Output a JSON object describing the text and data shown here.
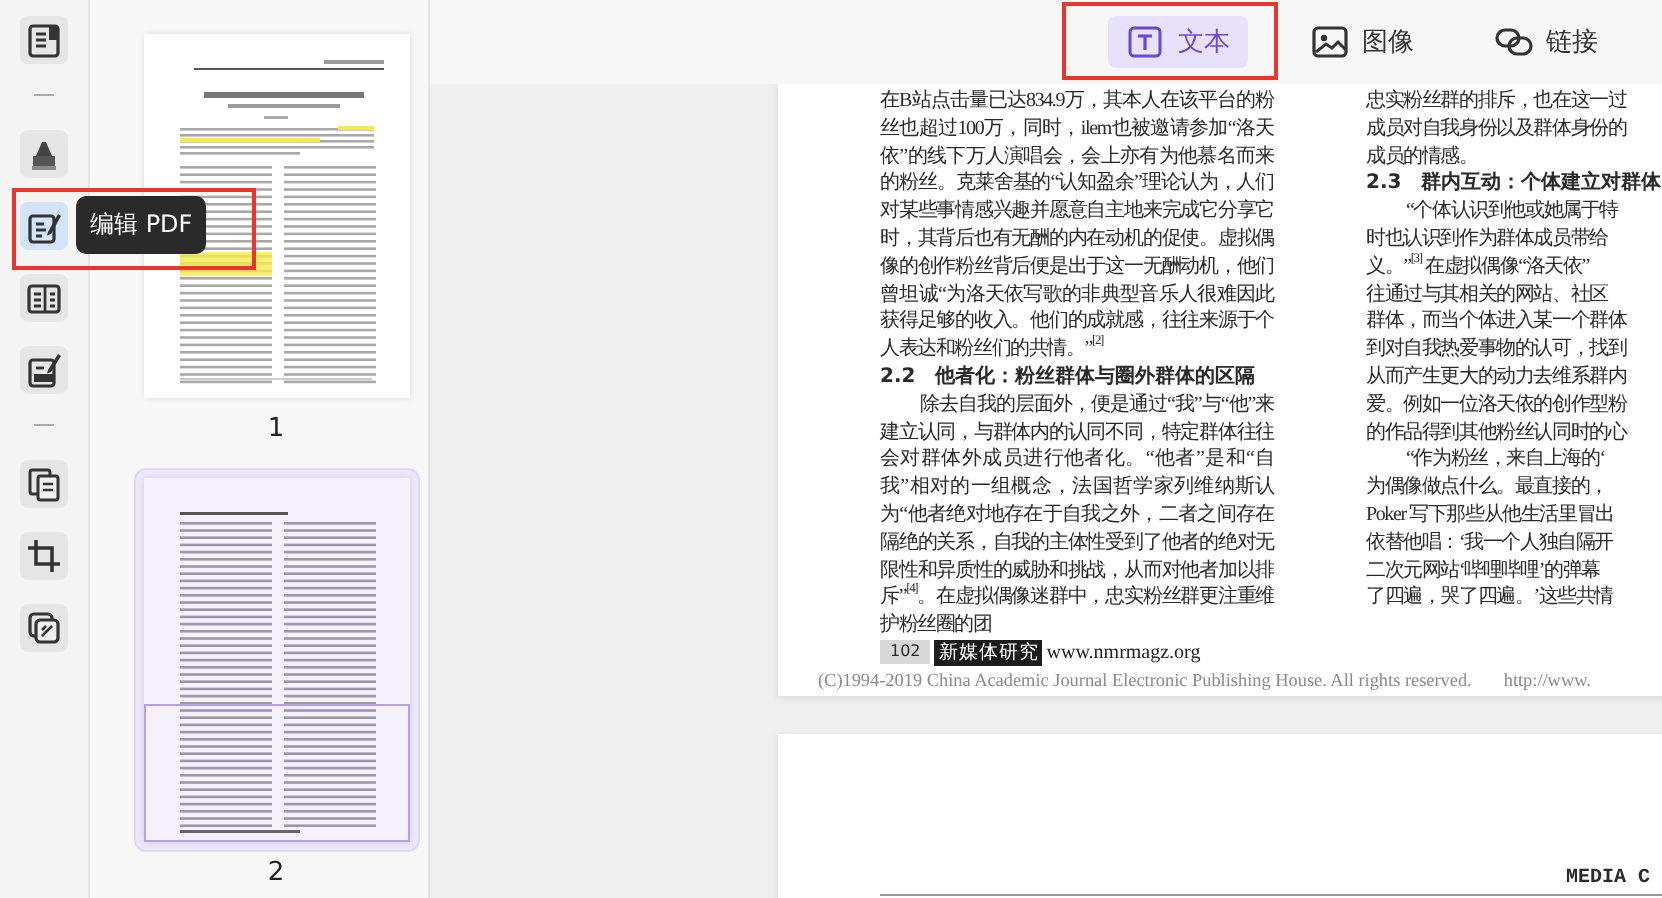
{
  "toolbar": {
    "tooltip": "编辑 PDF",
    "tool_groups": [
      {
        "tools": [
          {
            "kind": "reader",
            "selected": false,
            "annotated": false
          }
        ]
      },
      {
        "tools": [
          {
            "kind": "highlighter",
            "selected": false,
            "annotated": false
          },
          {
            "kind": "edit",
            "selected": true,
            "annotated": true
          },
          {
            "kind": "columns",
            "selected": false,
            "annotated": false
          },
          {
            "kind": "form",
            "selected": false,
            "annotated": false
          }
        ]
      },
      {
        "tools": [
          {
            "kind": "pages",
            "selected": false,
            "annotated": false
          },
          {
            "kind": "crop",
            "selected": false,
            "annotated": false
          },
          {
            "kind": "layers",
            "selected": false,
            "annotated": false
          }
        ]
      }
    ]
  },
  "thumbnails": [
    {
      "label": "1",
      "kind": "title_page",
      "selected": false
    },
    {
      "label": "2",
      "kind": "body_page",
      "selected": true
    }
  ],
  "edit_tabs": [
    {
      "kind": "text",
      "label": "文本",
      "selected": true,
      "annotated": true
    },
    {
      "kind": "image",
      "label": "图像",
      "selected": false,
      "annotated": false
    },
    {
      "kind": "link",
      "label": "链接",
      "selected": false,
      "annotated": false
    }
  ],
  "document": {
    "page_1": {
      "left_column": [
        {
          "kind": "paragraph",
          "indent": false,
          "text": "在B站点击量已达834.9万，其本人在该平台的粉丝也超过100万，同时，ilem也被邀请参加“洛天依”的线下万人演唱会，会上亦有为他慕名而来的粉丝。克莱舍基的“认知盈余”理论认为，人们对某些事情感兴趣并愿意自主地来完成它分享它时，其背后也有无酬的内在动机的促使。虚拟偶像的创作粉丝背后便是出于这一无酬动机，他们曾坦诚“为洛天依写歌的非典型音乐人很难因此获得足够的收入。他们的成就感，往往来源于个人表达和粉丝们的共情。”$^{[2]}$"
        },
        {
          "kind": "heading",
          "indent": false,
          "text": "2.2　他者化：粉丝群体与圈外群体的区隔"
        },
        {
          "kind": "paragraph",
          "indent": true,
          "text": "除去自我的层面外，便是通过“我”与“他”来建立认同，与群体内的认同不同，特定群体往往会对群体外成员进行他者化。“他者”是和“自我”相对的一组概念，法国哲学家列维纳斯认为“他者绝对地存在于自我之外，二者之间存在隔绝的关系，自我的主体性受到了他者的绝对无限性和异质性的威胁和挑战，从而对他者加以排斥”$^{[4]}$。在虚拟偶像迷群中，忠实粉丝群更注重维护粉丝圈的团"
        }
      ],
      "right_column": [
        {
          "kind": "line",
          "indent": false,
          "text": "忠实粉丝群的排斥，也在这一过"
        },
        {
          "kind": "line",
          "indent": false,
          "text": "成员对自我身份以及群体身份的"
        },
        {
          "kind": "line",
          "indent": false,
          "text": "成员的情感。"
        },
        {
          "kind": "heading",
          "indent": false,
          "text": "2.3　群内互动：个体建立对群体"
        },
        {
          "kind": "line",
          "indent": true,
          "text": "“个体认识到他或她属于特"
        },
        {
          "kind": "line",
          "indent": false,
          "text": "时也认识到作为群体成员带给"
        },
        {
          "kind": "line",
          "indent": false,
          "text": "义。”$^{[3]}$ 在虚拟偶像“洛天依”"
        },
        {
          "kind": "line",
          "indent": false,
          "text": "往通过与其相关的网站、社区"
        },
        {
          "kind": "line",
          "indent": false,
          "text": "群体，而当个体进入某一个群体"
        },
        {
          "kind": "line",
          "indent": false,
          "text": "到对自我热爱事物的认可，找到"
        },
        {
          "kind": "line",
          "indent": false,
          "text": "从而产生更大的动力去维系群内"
        },
        {
          "kind": "line",
          "indent": false,
          "text": "爱。例如一位洛天依的创作型粉"
        },
        {
          "kind": "line",
          "indent": false,
          "text": "的作品得到其他粉丝认同时的心"
        },
        {
          "kind": "line",
          "indent": true,
          "text": "“作为粉丝，来自上海的‘"
        },
        {
          "kind": "line",
          "indent": false,
          "text": "为偶像做点什么。最直接的，"
        },
        {
          "kind": "line",
          "indent": false,
          "text": "Poker 写下那些从他生活里冒出"
        },
        {
          "kind": "line",
          "indent": false,
          "text": "依替他唱：‘我一个人独自隔开"
        },
        {
          "kind": "line",
          "indent": false,
          "text": "二次元网站‘哔哩哔哩’的弹幕"
        },
        {
          "kind": "line",
          "indent": false,
          "text": "了四遍，哭了四遍。’这些共情"
        }
      ],
      "footer": {
        "page_number": "102",
        "journal": "新媒体研究",
        "website": "www.nmrmagz.org"
      },
      "copyright": "(C)1994-2019 China Academic Journal Electronic Publishing House. All rights reserved.",
      "copyright_url": "http://www."
    },
    "page_2": {
      "header": "MEDIA C"
    }
  }
}
